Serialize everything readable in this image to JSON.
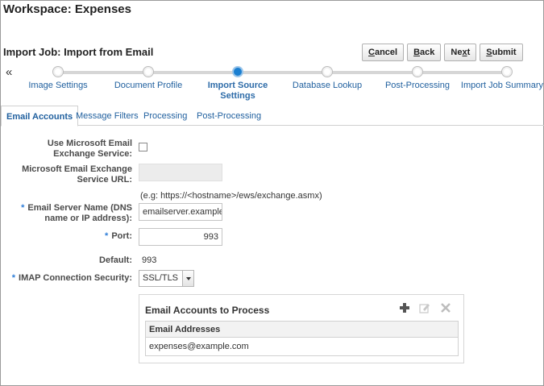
{
  "workspace_title": "Workspace: Expenses",
  "job_title": "Import Job: Import from Email",
  "buttons": {
    "cancel": {
      "u": "C",
      "rest": "ancel"
    },
    "back": {
      "u": "B",
      "rest": "ack"
    },
    "next": {
      "pre": "Ne",
      "u": "x",
      "rest": "t"
    },
    "submit": {
      "pre": "",
      "u": "S",
      "rest": "ubmit"
    }
  },
  "collapse_glyph": "«",
  "train": {
    "steps": [
      {
        "label": "Image Settings",
        "active": false
      },
      {
        "label": "Document Profile",
        "active": false
      },
      {
        "label": "Import Source Settings",
        "active": true
      },
      {
        "label": "Database Lookup",
        "active": false
      },
      {
        "label": "Post-Processing",
        "active": false
      },
      {
        "label": "Import Job Summary",
        "active": false
      }
    ]
  },
  "tabs": [
    {
      "label": "Email Accounts",
      "active": true
    },
    {
      "label": "Message Filters",
      "active": false
    },
    {
      "label": "Processing",
      "active": false
    },
    {
      "label": "Post-Processing",
      "active": false
    }
  ],
  "form": {
    "use_exchange_label": "Use Microsoft Email Exchange Service:",
    "use_exchange_checked": false,
    "exchange_url_label": "Microsoft Email Exchange Service URL:",
    "exchange_url_value": "",
    "exchange_url_hint": "(e.g: https://<hostname>/ews/exchange.asmx)",
    "server_name_label": "Email Server Name (DNS name or IP address):",
    "server_name_value": "emailserver.example.c",
    "port_label": "Port:",
    "port_value": "993",
    "default_label": "Default:",
    "default_value": "993",
    "imap_label": "IMAP Connection Security:",
    "imap_value": "SSL/TLS",
    "required_marker": "*"
  },
  "accounts_panel": {
    "title": "Email Accounts to Process",
    "column_header": "Email Addresses",
    "rows": [
      "expenses@example.com"
    ],
    "icons": [
      "add-icon",
      "edit-icon",
      "delete-icon"
    ]
  },
  "colors": {
    "accent": "#1b7fd1",
    "link": "#1f5f9e",
    "required": "#2f7ed8"
  }
}
